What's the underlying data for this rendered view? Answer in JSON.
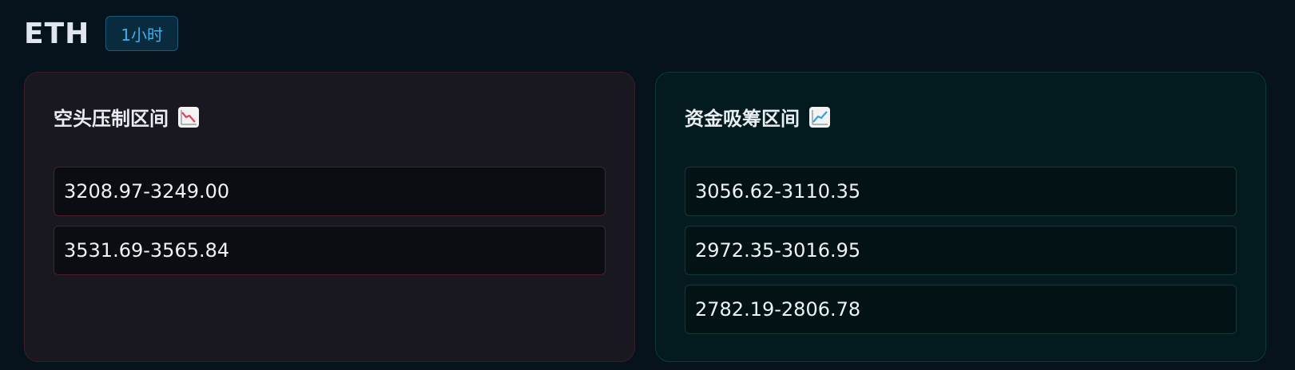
{
  "header": {
    "symbol": "ETH",
    "timeframe": "1小时"
  },
  "bear_panel": {
    "title": "空头压制区间",
    "icon": "chart-decreasing-icon",
    "ranges": [
      "3208.97-3249.00",
      "3531.69-3565.84"
    ]
  },
  "bull_panel": {
    "title": "资金吸筹区间",
    "icon": "chart-increasing-icon",
    "ranges": [
      "3056.62-3110.35",
      "2972.35-3016.95",
      "2782.19-2806.78"
    ]
  },
  "colors": {
    "background": "#06121c",
    "bear_accent": "#e0445a",
    "bull_accent": "#3aa0e0",
    "timeframe_text": "#3fb0e8"
  }
}
